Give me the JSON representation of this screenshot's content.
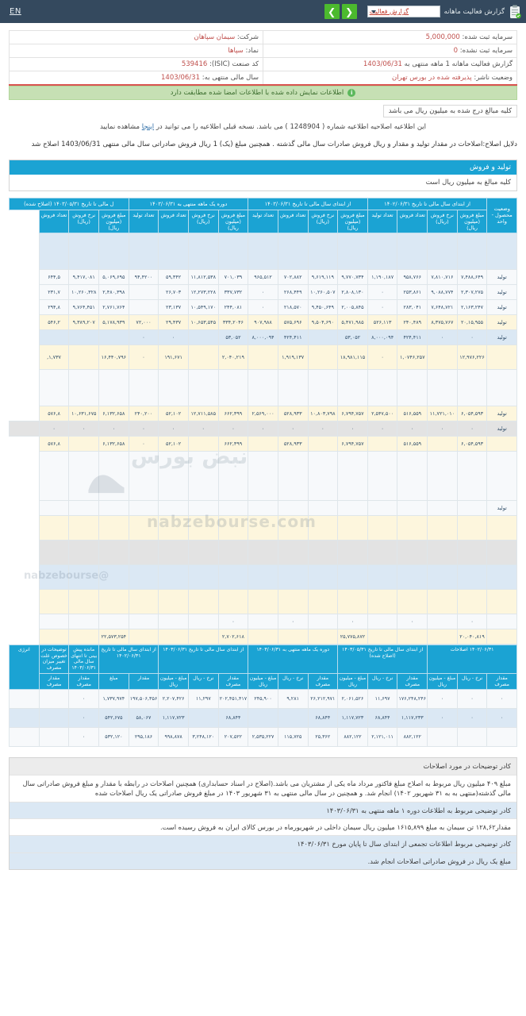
{
  "topbar": {
    "clipboard_icon": "clipboard-icon",
    "title": "گزارش فعالیت ماهانه",
    "report_select_value": "گزارش فعالیت",
    "prev_label": "❮",
    "next_label": "❯",
    "lang_label": "EN",
    "accent_color": "#34495e",
    "nav_button_color": "#4cba2e"
  },
  "info": {
    "company_label": "شرکت:",
    "company_value": "سیمان سپاهان",
    "capital_registered_label": "سرمایه ثبت شده:",
    "capital_registered_value": "5,000,000",
    "symbol_label": "نماد:",
    "symbol_value": "سپاها",
    "capital_unregistered_label": "سرمایه ثبت نشده:",
    "capital_unregistered_value": "0",
    "isic_label": "کد صنعت (ISIC):",
    "isic_value": "539416",
    "period_label": "گزارش فعالیت ماهانه 1 ماهه منتهی به",
    "period_value": "1403/06/31",
    "fiscal_year_label": "سال مالی منتهی به:",
    "fiscal_year_value": "1403/06/31",
    "status_label": "وضعیت ناشر:",
    "status_value": "پذیرفته شده در بورس تهران"
  },
  "banner": {
    "icon": "info-icon",
    "text": "اطلاعات نمایش داده شده با اطلاعات امضا شده مطابقت دارد"
  },
  "notes_top": {
    "unit_note": "کلیه مبالغ درج شده به میلیون ریال می باشد",
    "correction_note_pre": "این اطلاعیه اصلاحیه اطلاعیه شماره (",
    "correction_number": "1248904",
    "correction_note_mid": ") می باشد. نسخه قبلی اطلاعیه را می توانید در",
    "correction_link": "اینجا",
    "correction_note_post": "مشاهده نمایید",
    "reason": "دلایل اصلاح:اصلاحات در مقدار تولید و مقدار و ریال فروش صادرات سال مالی گذشته . همچنین مبلغ (یک) 1 ریال فروش صادراتی سال مالی منتهی 1403/06/31 اصلاح شد"
  },
  "production_section": {
    "title": "تولید و فروش",
    "subtitle": "کلیه مبالغ به میلیون ریال است"
  },
  "production_table": {
    "groups": [
      {
        "label": "وضعیت محصول - واحد",
        "span": 1
      },
      {
        "label": "از ابتدای سال مالی تا تاریخ ۱۴۰۲/۰۶/۳۱",
        "span": 4
      },
      {
        "label": "از ابتدای سال مالی تا تاریخ ۱۴۰۳/۰۶/۳۱",
        "span": 4
      },
      {
        "label": "دوره یک ماهه منتهی به ۱۴۰۳/۰۶/۳۱",
        "span": 4
      },
      {
        "label": "ل مالی تا تاریخ ۱۴۰۳/۰۵/۳۱ (اصلاح شده)",
        "span": 4
      }
    ],
    "columns": [
      "وضعیت محصول- واحد",
      "مبلغ فروش (میلیون ریال)",
      "نرخ فروش (ریال)",
      "تعداد فروش",
      "تعداد تولید",
      "مبلغ فروش (میلیون ریال)",
      "نرخ فروش (ریال)",
      "تعداد فروش",
      "تعداد تولید",
      "مبلغ فروش (میلیون ریال)",
      "نرخ فروش (ریال)",
      "تعداد فروش",
      "تعداد تولید",
      "مبلغ فروش (میلیون ریال)",
      "نرخ فروش (ریال)",
      "تعداد فروش"
    ],
    "rows": [
      {
        "style": "rw-blue",
        "height": "rw-xtall",
        "cells": [
          "",
          "",
          "",
          "",
          "",
          "",
          "",
          "",
          "",
          "",
          "",
          "",
          "",
          "",
          "",
          ""
        ]
      },
      {
        "style": "rw-white",
        "height": "",
        "cells": [
          "تولید",
          "۷,۴۸۸,۶۴۹",
          "۷,۸۱۰,۷۱۶",
          "۹۵۸,۷۶۶",
          "۱,۱۹۰,۱۸۷",
          "۹,۷۷۰,۷۳۴",
          "۹,۶۱۹,۱۱۹",
          "۷۰۲,۸۸۲",
          "۹۶۵,۵۱۲",
          "۷۰۱,۰۳۹",
          "۱۱,۸۱۲,۵۳۸",
          "۵۹,۳۴۲",
          "۹۴,۴۲۰۰",
          "۵,۰۶۹,۶۹۵",
          "۹,۴۱۷,۰۸۱",
          "۶۴۴,۵"
        ]
      },
      {
        "style": "rw-white",
        "height": "",
        "cells": [
          "تولید",
          "۲,۳۰۷,۲۷۵",
          "۹,۰۸۸,۷۷۴",
          "۲۵۳,۸۶۱",
          "۰",
          "۲,۸۰۸,۱۳۰",
          "۱۰,۲۶۰,۵۰۷",
          "۲۶۸,۴۴۹",
          "۰",
          "۳۳۷,۷۳۲",
          "۱۲,۲۷۳,۲۲۸",
          "۲۶,۷۰۳",
          "",
          "۲,۴۸۰,۳۹۸",
          "۱۰,۲۶۰,۳۲۸",
          "۲۳۱,۷"
        ]
      },
      {
        "style": "rw-white",
        "height": "",
        "cells": [
          "تولید",
          "۲,۱۶۳,۲۴۷",
          "۷,۶۴۸,۷۲۱",
          "۲۸۳,۰۴۱",
          "۰",
          "۲,۰۰۵,۸۴۵",
          "۹,۴۵۰,۶۴۹",
          "۲۱۸,۵۷۰",
          "۰",
          "۲۴۴,۰۸۱",
          "۱۰,۵۴۹,۱۷۰",
          "۲۳,۱۳۷",
          "",
          "۲,۷۶۱,۷۶۴",
          "۹,۷۶۴,۴۵۱",
          "۲۹۴,۸"
        ]
      },
      {
        "style": "rw-cream",
        "height": "",
        "cells": [
          "تولید",
          "۲۰,۱۵,۹۵۵",
          "۸,۳۷۵,۷۶۷",
          "۲۴۰,۴۸۹",
          "۵۲۶,۱۱۳",
          "۵,۴۷۱,۹۸۵",
          "۹,۵۰۴,۶۹۰",
          "۵۷۵,۶۹۶",
          "۹۰۷,۹۸۸",
          "۳۳۴,۲۰۴۶",
          "۱۰,۶۵۳,۵۴۵",
          "۲۹,۴۳۷",
          "۷۲,۰۰۰",
          "۵,۱۷۸,۹۳۹",
          "۹,۳۸۹,۲۰۷",
          "۵۴۶,۲"
        ]
      },
      {
        "style": "rw-blue",
        "height": "",
        "cells": [
          "تولید",
          "۰",
          "۰",
          "۴۲۴,۴۱۱",
          "۸,۰۰۰,۰۹۴",
          "۵۳,۰۵۲",
          "",
          "۴۲۴,۴۱۱",
          "۸,۰۰۰,۰۹۴",
          "۵۳,۰۵۲",
          "",
          "۰",
          "۰",
          "",
          "",
          ""
        ]
      },
      {
        "style": "rw-cream",
        "height": "rw-tall",
        "cells": [
          "",
          "۱۲,۹۷۶,۲۲۶",
          "",
          "۱,۰۷۴۶,۲۵۷",
          "۰",
          "۱۸,۹۸۱,۱۱۵",
          "",
          "۱,۹۱۹,۱۳۷",
          "",
          "۲,۰۴۰,۲۱۹",
          "",
          "۱۹۱,۶۷۱",
          "۰",
          "۱۶,۴۴۰,۷۹۶",
          "",
          "۱,۷۳۷,"
        ]
      },
      {
        "style": "rw-white",
        "height": "rw-xtall",
        "cells": [
          "",
          "",
          "",
          "",
          "",
          "",
          "",
          "",
          "",
          "",
          "",
          "",
          "",
          "",
          "",
          ""
        ]
      },
      {
        "style": "rw-cream",
        "height": "",
        "cells": [
          "تولید",
          "۶,۰۵۴,۵۹۳",
          "۱۱,۷۲۱,۰۱۰",
          "۵۱۶,۵۵۹",
          "۲,۵۴۷,۵۰۰",
          "۶,۷۹۴,۷۵۷",
          "۱۰,۸۰۳,۷۹۸",
          "۵۲۸,۹۳۳",
          "۲,۵۶۹,۰۰۰",
          "۶۶۲,۳۹۹",
          "۱۲,۷۱۱,۵۸۵",
          "۵۲,۱۰۲",
          "۲۴۰,۲۰۰",
          "۶,۱۳۲,۶۵۸",
          "۱۰,۶۳۱,۶۷۵",
          "۵۷۶,۸"
        ]
      },
      {
        "style": "rw-gray",
        "height": "",
        "cells": [
          "تولید",
          "۰",
          "۰",
          "۰",
          "۰",
          "۰",
          "۰",
          "۰",
          "۰",
          "۰",
          "۰",
          "۰",
          "۰",
          "۰",
          "۰",
          "۰",
          ""
        ]
      },
      {
        "style": "rw-cream",
        "height": "",
        "cells": [
          "",
          "۶,۰۵۴,۵۹۳",
          "",
          "۵۱۶,۵۵۹",
          "",
          "۶,۷۹۴,۷۵۷",
          "",
          "۵۲۸,۹۳۳",
          "",
          "۶۶۲,۳۹۹",
          "",
          "۵۲,۱۰۲",
          "۰",
          "۶,۱۳۲,۶۵۸",
          "",
          "۵۷۶,۸"
        ]
      },
      {
        "style": "rw-white",
        "height": "rw-xxtall",
        "cells": [
          "",
          "",
          "",
          "",
          "",
          "",
          "",
          "",
          "",
          "",
          "",
          "",
          "",
          "",
          "",
          ""
        ]
      },
      {
        "style": "rw-white",
        "height": "",
        "cells": [
          "تولید",
          "",
          "",
          "",
          "",
          "",
          "",
          "",
          "",
          "",
          "",
          "",
          "",
          "",
          "",
          ""
        ]
      },
      {
        "style": "rw-cream",
        "height": "rw-tall",
        "cells": [
          "",
          "",
          "",
          "",
          "",
          "",
          "",
          "",
          "",
          "",
          "",
          "",
          "",
          "",
          "",
          ""
        ]
      },
      {
        "style": "rw-gray",
        "height": "rw-tall",
        "cells": [
          "",
          "",
          "",
          "",
          "",
          "",
          "",
          "",
          "",
          "",
          "",
          "",
          "",
          "",
          "",
          ""
        ]
      },
      {
        "style": "rw-blue",
        "height": "rw-tall",
        "cells": [
          "",
          "",
          "",
          "",
          "",
          "",
          "",
          "",
          "",
          "",
          "",
          "",
          "",
          "",
          "",
          ""
        ]
      },
      {
        "style": "rw-cream",
        "height": "rw-tall",
        "cells": [
          "",
          "",
          "",
          "",
          "",
          "",
          "",
          "",
          "",
          "",
          "",
          "",
          "",
          "",
          "",
          ""
        ]
      },
      {
        "style": "rw-white",
        "height": "",
        "cells": [
          "",
          "۰",
          "",
          "۰",
          "",
          "۰",
          "",
          "۰",
          "",
          "۰",
          "",
          "",
          "",
          "",
          "",
          ""
        ]
      },
      {
        "style": "rw-cream",
        "height": "",
        "cells": [
          "",
          "۲۰,۰۴۰,۸۱۹",
          "",
          "",
          "",
          "۲۵,۷۷۵,۸۷۲",
          "",
          "",
          "",
          "۲,۷۰۲,۶۱۸",
          "",
          "",
          "",
          "۲۲,۵۷۳,۲۵۴",
          "",
          ""
        ]
      }
    ]
  },
  "energy_section": {
    "title": "انرژی",
    "groups": [
      {
        "label": "۱۴۰۲/۰۶/۳۱ اصلاحات",
        "span": 3
      },
      {
        "label": "از ابتدای سال مالی تا تاریخ ۱۴۰۳/۰۵/۳۱ (اصلاح شده)",
        "span": 3
      },
      {
        "label": "دوره یک ماهه منتهی به ۱۴۰۳/۰۶/۳۱",
        "span": 3
      },
      {
        "label": "از ابتدای سال مالی تا تاریخ ۱۴۰۳/۰۶/۳۱",
        "span": 3
      },
      {
        "label": "از ابتدای سال مالی تا تاریخ ۱۴۰۲/۰۶/۳۱",
        "span": 2
      },
      {
        "label": "مانده پیش بینی تا انتهای سال مالی ۱۴۰۳/۰۶/۳۱",
        "span": 1
      },
      {
        "label": "توضیحات در خصوص علت تغییر میزان مصرف",
        "span": 1
      }
    ],
    "columns": [
      "مقدار مصرف",
      "نرخ - ریال",
      "مبلغ - میلیون ریال",
      "مقدار مصرف",
      "نرخ - ریال",
      "مبلغ - میلیون ریال",
      "مقدار مصرف",
      "نرخ - ریال",
      "مبلغ - میلیون ریال",
      "مقدار مصرف",
      "نرخ - ریال",
      "مبلغ - میلیون ریال",
      "مقدار",
      "مبلغ",
      "مقدار مصرف",
      "مقدار مصرف"
    ],
    "rows": [
      {
        "alt": false,
        "cells": [
          "۰",
          "۰",
          "۰",
          "۱۷۶,۲۴۸,۲۴۶",
          "۱۱,۶۹۷",
          "۲,۰۶۱,۵۲۶",
          "۲۶,۲۱۲,۹۷۱",
          "۹,۲۸۱",
          "۲۴۵,۹۰۰",
          "۲۰۲,۴۵۱,۴۱۷",
          "۱۱,۲۹۷",
          "۲,۲۰۷,۴۲۶",
          "۱۹۷,۵۰۶,۳۵۶",
          "۱,۷۳۷,۹۷۴",
          "۰",
          ""
        ]
      },
      {
        "alt": true,
        "cells": [
          "۰",
          "۰",
          "۰",
          "۱,۱۱۷,۲۳۳",
          "۶۸,۸۴۴",
          "۱,۱۱۷,۷۲۳",
          "۶۸,۸۴۴",
          "",
          "",
          "۶۸,۸۴۴",
          "",
          "۱,۱۱۷,۷۲۳",
          "۵۸,۰۶۷",
          "۵۴۲,۶۷۵",
          "۰",
          ""
        ]
      },
      {
        "alt": false,
        "cells": [
          "",
          "",
          "",
          "۸۸۲,۱۲۲",
          "۲,۱۲۱,۰۱۱",
          "۸۸۲,۱۲۲",
          "۲۵,۳۶۲",
          "۱۱۵,۷۲۵",
          "۲,۵۳۵,۲۲۷",
          "۲۰۷,۵۲۲",
          "۳,۲۴۸,۱۲۰",
          "۹۹۸,۸۷۸",
          "۲۹۵,۱۸۶",
          "۵۳۲,۱۲۰",
          "۰",
          ""
        ]
      }
    ]
  },
  "footer_notes": {
    "header": "کادر توضیحات در مورد اصلاحات",
    "rows": [
      "مبلغ ۴۰۹ میلیون ریال مربوط به اصلاح مبلغ فاکتور مرداد ماه یکی از مشتریان می باشد.(اصلاح در اسناد حسابداری) همچنین اصلاحات در رابطه با مقدار و مبلغ فروش صادراتی سال مالی گذشته(منتهی به به ۳۱ شهریور ۱۴۰۲) انجام شد. و همچنین در سال مالی منتهی به ۳۱ شهریور ۱۴۰۳ در مبلغ فروش صادراتی یک ریال اصلاحات شده",
      "کادر توضیحی مربوط به اطلاعات دوره ۱ ماهه منتهی به ۱۴۰۳/۰۶/۳۱",
      "مقدار۱۲۸,۶۲ تن سیمان به مبلغ ۱۶۱۵,۸۹۹ میلیون ریال سیمان داخلی در شهریورماه در بورس کالای ایران به فروش رسیده است.",
      "کادر توضیحی مربوط اطلاعات تجمعی از ابتدای سال تا پایان مورخ ۱۴۰۳/۰۶/۳۱",
      "مبلغ یک ریال در فروش صادراتی اصلاحات انجام شد."
    ]
  },
  "watermark": {
    "brand_fa": "نبض بورس",
    "brand_en": "nabzebourse.com",
    "handle": "@nabzebourse"
  }
}
